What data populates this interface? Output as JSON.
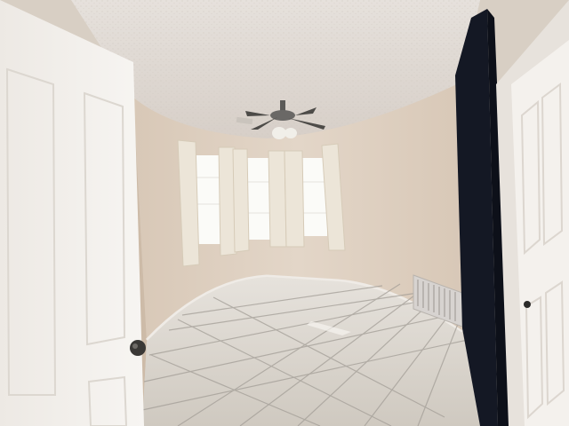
{
  "scene": {
    "description_free": true,
    "colors": {
      "ceiling": "#e2dcd6",
      "wall": "#d9c8b6",
      "wall_shadow": "#c9b7a4",
      "floor": "#d9d4cc",
      "grout": "#8e8a84",
      "door": "#f1eeea",
      "door_trim": "#e8e4de",
      "curtain": "#ece6da",
      "window_glow": "#fbfbf8",
      "dark_curtain": "#141824",
      "fan": "#5b5a58",
      "vent": "#d7d3d0"
    },
    "objects": [
      "ceiling",
      "ceiling-fan",
      "curved-wall",
      "bay-windows",
      "sheer-curtains",
      "tile-floor",
      "floor-vent",
      "open-door",
      "door-knob",
      "closet-door",
      "dark-curtain"
    ]
  }
}
